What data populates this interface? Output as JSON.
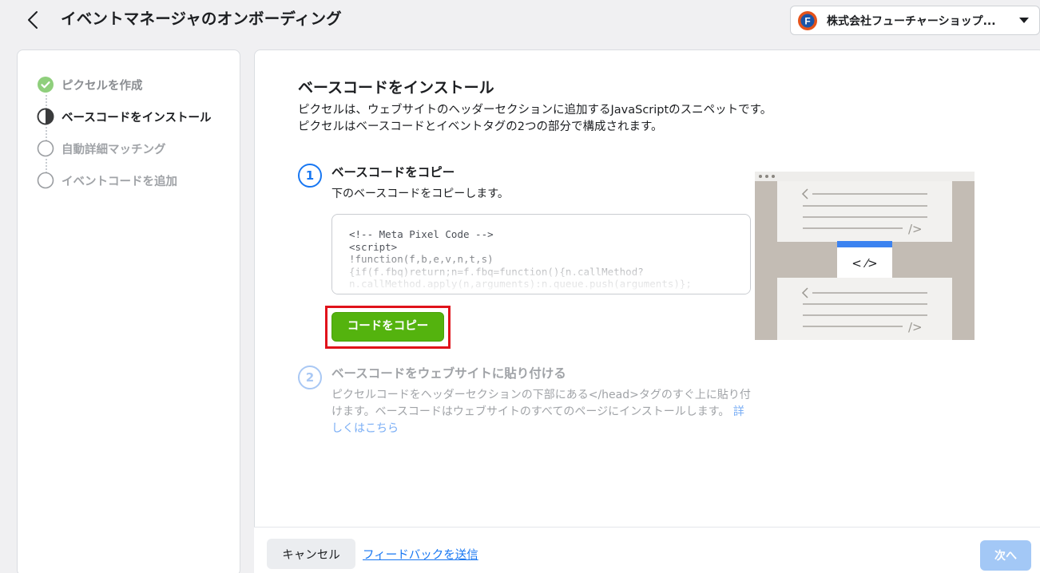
{
  "header": {
    "title": "イベントマネージャのオンボーディング",
    "back_icon": "chevron-left-icon",
    "account": {
      "name": "株式会社フューチャーショップ...",
      "logo_letter": "F",
      "logo_color": "#e5531a",
      "logo_inner_color": "#1b54a8"
    }
  },
  "sidebar": {
    "steps": [
      {
        "label": "ピクセルを作成",
        "state": "completed",
        "icon": "check-circle-icon"
      },
      {
        "label": "ベースコードをインストール",
        "state": "current",
        "icon": "half-circle-icon"
      },
      {
        "label": "自動詳細マッチング",
        "state": "pending",
        "icon": "empty-circle-icon"
      },
      {
        "label": "イベントコードを追加",
        "state": "pending",
        "icon": "empty-circle-icon"
      }
    ]
  },
  "main": {
    "title": "ベースコードをインストール",
    "description": "ピクセルは、ウェブサイトのヘッダーセクションに追加するJavaScriptのスニペットです。ピクセルはベースコードとイベントタグの2つの部分で構成されます。",
    "step1": {
      "number": "1",
      "title": "ベースコードをコピー",
      "description": "下のベースコードをコピーします。",
      "code": "<!-- Meta Pixel Code -->\n<script>\n!function(f,b,e,v,n,t,s)\n{if(f.fbq)return;n=f.fbq=function(){n.callMethod?\nn.callMethod.apply(n,arguments):n.queue.push(arguments)};",
      "copy_button": "コードをコピー"
    },
    "step2": {
      "number": "2",
      "title": "ベースコードをウェブサイトに貼り付ける",
      "description": "ピクセルコードをヘッダーセクションの下部にある</head>タグのすぐ上に貼り付けます。ベースコードはウェブサイトのすべてのページにインストールします。",
      "link": "詳しくはこちら"
    },
    "illustration": {
      "code_glyph": "< ⁄>",
      "end_glyph": "/>"
    }
  },
  "footer": {
    "cancel_label": "キャンセル",
    "feedback_label": "フィードバックを送信",
    "next_label": "次へ"
  },
  "colors": {
    "accent": "#1877f2",
    "copy_button": "#54b30e",
    "highlight": "#e0121b",
    "complete": "#6fc35e"
  }
}
